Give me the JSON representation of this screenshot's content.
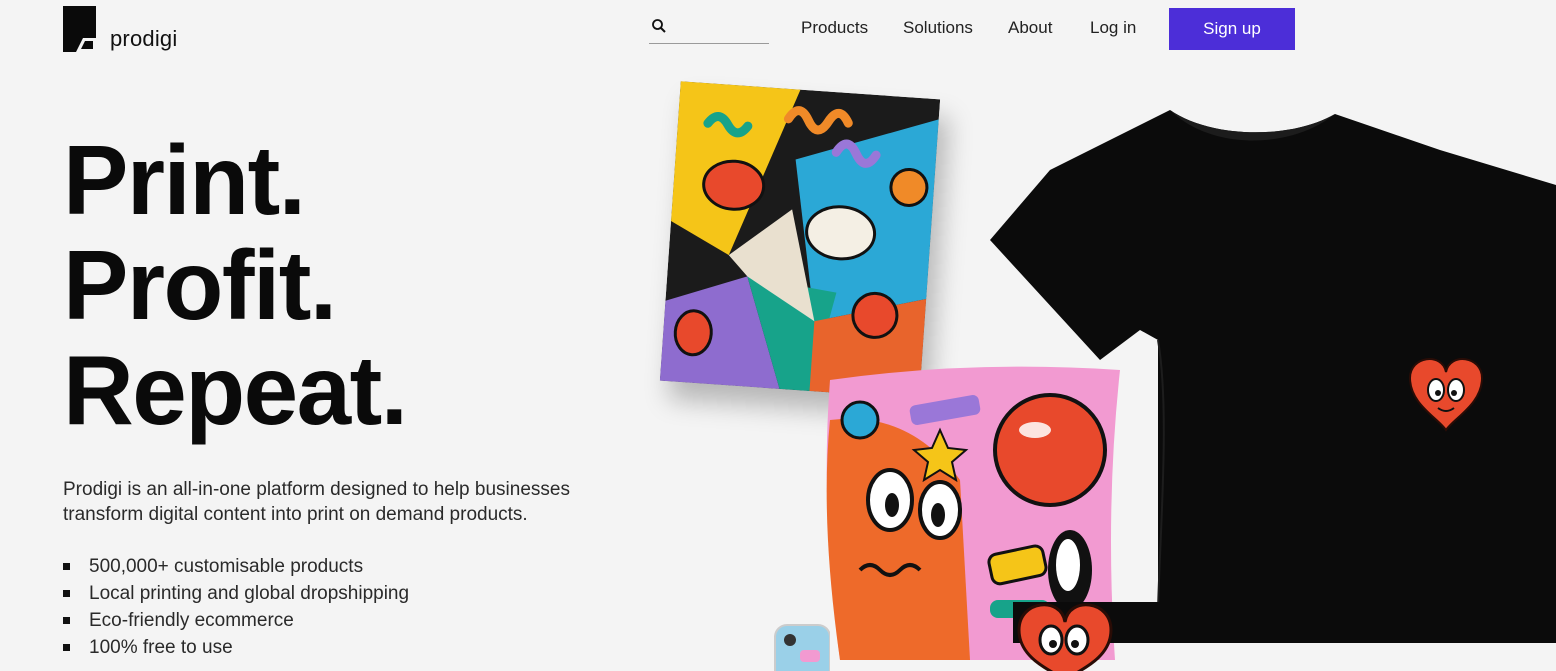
{
  "brand": {
    "name": "prodigi"
  },
  "search": {
    "placeholder": ""
  },
  "nav": {
    "products": "Products",
    "solutions": "Solutions",
    "about": "About",
    "login": "Log in",
    "signup": "Sign up"
  },
  "hero": {
    "lines": [
      "Print.",
      "Profit.",
      "Repeat."
    ],
    "description": "Prodigi is an all-in-one platform designed to help businesses transform digital content into print on demand products.",
    "features": [
      "500,000+ customisable products",
      "Local printing and global dropshipping",
      "Eco-friendly ecommerce",
      "100% free to use"
    ]
  },
  "colors": {
    "accent": "#4c2ed8",
    "background": "#f4f4f4",
    "text": "#111111"
  },
  "icons": [
    "logo-mark",
    "search-icon"
  ]
}
